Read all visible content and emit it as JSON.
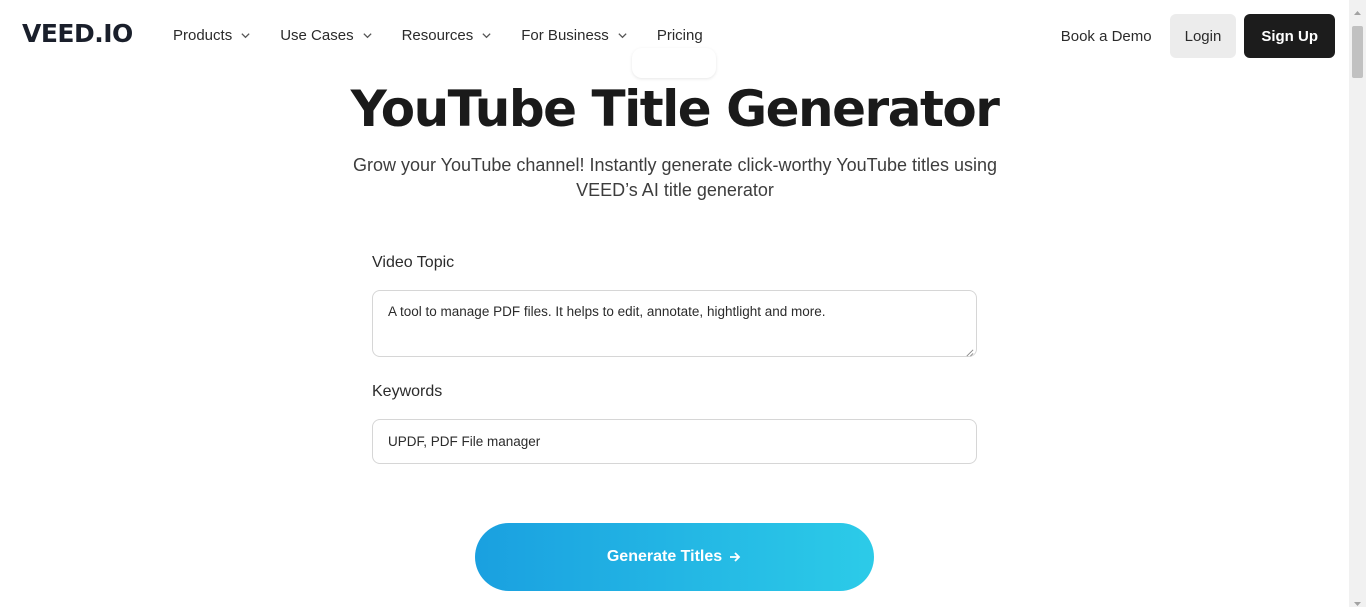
{
  "nav": {
    "logo": "VEED.IO",
    "menu": [
      {
        "label": "Products",
        "dropdown": true
      },
      {
        "label": "Use Cases",
        "dropdown": true
      },
      {
        "label": "Resources",
        "dropdown": true
      },
      {
        "label": "For Business",
        "dropdown": true
      },
      {
        "label": "Pricing",
        "dropdown": false
      }
    ],
    "book_demo": "Book a Demo",
    "login": "Login",
    "signup": "Sign Up"
  },
  "hero": {
    "title": "YouTube Title Generator",
    "subtitle_line1": "Grow your YouTube channel! Instantly generate click-worthy YouTube titles using",
    "subtitle_line2": "VEED’s AI title generator"
  },
  "form": {
    "topic_label": "Video Topic",
    "topic_value": "A tool to manage PDF files. It helps to edit, annotate, hightlight and more.",
    "keywords_label": "Keywords",
    "keywords_value": "UPDF, PDF File manager",
    "generate_label": "Generate Titles"
  },
  "icons": {
    "menu_chevron": "chevron-down-icon",
    "generate_arrow": "arrow-right-icon"
  },
  "colors": {
    "button_gradient_start": "#1aa0e0",
    "button_gradient_end": "#2ccbe8",
    "signup_bg": "#1c1c1c",
    "login_bg": "#ececec"
  }
}
